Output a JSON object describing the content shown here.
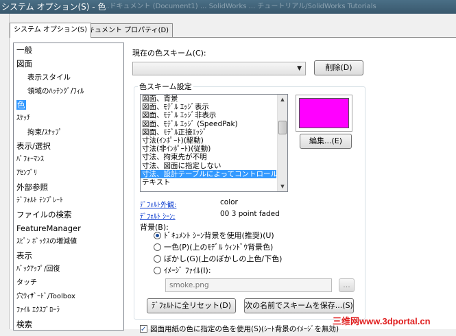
{
  "window": {
    "title": "システム オプション(S) - 色",
    "background_title": "...ドキュメント (Document1) ... SolidWorks ... チュートリアル/SolidWorks Tutorials"
  },
  "tabs": [
    {
      "label": "システム オプション(S)",
      "active": true
    },
    {
      "label": "ドキュメント プロパティ(D)",
      "active": false
    }
  ],
  "tree": {
    "items": [
      {
        "label": "一般",
        "level": 0,
        "selected": false
      },
      {
        "label": "図面",
        "level": 0,
        "selected": false
      },
      {
        "label": "表示スタイル",
        "level": 1,
        "selected": false
      },
      {
        "label": "領域のﾊｯﾁﾝｸﾞ/ﾌｨﾙ",
        "level": 1,
        "selected": false
      },
      {
        "label": "色",
        "level": 0,
        "selected": true
      },
      {
        "label": "ｽｹｯﾁ",
        "level": 0,
        "selected": false
      },
      {
        "label": "拘束/ｽﾅｯﾌﾟ",
        "level": 1,
        "selected": false
      },
      {
        "label": "表示/選択",
        "level": 0,
        "selected": false
      },
      {
        "label": "ﾊﾟﾌｫｰﾏﾝｽ",
        "level": 0,
        "selected": false
      },
      {
        "label": "ｱｾﾝﾌﾞﾘ",
        "level": 0,
        "selected": false
      },
      {
        "label": "外部参照",
        "level": 0,
        "selected": false
      },
      {
        "label": "ﾃﾞﾌｫﾙﾄ ﾃﾝﾌﾟﾚｰﾄ",
        "level": 0,
        "selected": false
      },
      {
        "label": "ファイルの検索",
        "level": 0,
        "selected": false
      },
      {
        "label": "FeatureManager",
        "level": 0,
        "selected": false
      },
      {
        "label": "ｽﾋﾟﾝ ﾎﾞｯｸｽの増減値",
        "level": 0,
        "selected": false
      },
      {
        "label": "表示",
        "level": 0,
        "selected": false
      },
      {
        "label": "ﾊﾞｯｸｱｯﾌﾟ/回復",
        "level": 0,
        "selected": false
      },
      {
        "label": "タッチ",
        "level": 0,
        "selected": false
      },
      {
        "label": "穴ｳｨｻﾞｰﾄﾞ/Toolbox",
        "level": 0,
        "selected": false
      },
      {
        "label": "ﾌｧｲﾙ ｴｸｽﾌﾟﾛｰﾗ",
        "level": 0,
        "selected": false
      },
      {
        "label": "検索",
        "level": 0,
        "selected": false
      }
    ]
  },
  "scheme": {
    "label": "現在の色スキーム(C):",
    "current_value": "",
    "delete_button": "削除(D)"
  },
  "color_settings": {
    "group_title": "色スキーム設定",
    "items": [
      {
        "label": "図面、背景",
        "selected": false
      },
      {
        "label": "図面、ﾓﾃﾞﾙ ｴｯｼﾞ表示",
        "selected": false
      },
      {
        "label": "図面、ﾓﾃﾞﾙ ｴｯｼﾞ非表示",
        "selected": false
      },
      {
        "label": "図面、ﾓﾃﾞﾙ ｴｯｼﾞ (SpeedPak)",
        "selected": false
      },
      {
        "label": "図面、ﾓﾃﾞﾙ正接ｴｯｼﾞ",
        "selected": false
      },
      {
        "label": "寸法(ｲﾝﾎﾟｰﾄ)(駆動)",
        "selected": false
      },
      {
        "label": "寸法(非ｲﾝﾎﾟｰﾄ)(従動)",
        "selected": false
      },
      {
        "label": "寸法、拘束先が不明",
        "selected": false
      },
      {
        "label": "寸法、図面に指定しない",
        "selected": false
      },
      {
        "label": "寸法、設計テーブルによってコントロール",
        "selected": true
      },
      {
        "label": "テキスト",
        "selected": false
      }
    ],
    "swatch_color": "#ff00ff",
    "edit_button": "編集...(E)"
  },
  "defaults": {
    "appearance_label": "ﾃﾞﾌｫﾙﾄ外観:",
    "appearance_value": "color",
    "scene_label": "ﾃﾞﾌｫﾙﾄ ｼｰﾝ:",
    "scene_value": "00 3 point faded"
  },
  "background": {
    "label": "背景(B):",
    "options": [
      {
        "label": "ﾄﾞｷｭﾒﾝﾄ ｼｰﾝ背景を使用(推奨)(U)",
        "selected": true
      },
      {
        "label": "一色(P)(上のﾓﾃﾞﾙ ｳｨﾝﾄﾞｳ背景色)",
        "selected": false
      },
      {
        "label": "ぼかし(G)(上のぼかしの上色/下色)",
        "selected": false
      },
      {
        "label": "ｲﾒｰｼﾞ ﾌｧｲﾙ(I):",
        "selected": false
      }
    ],
    "image_file": "smoke.png",
    "browse_button": "..."
  },
  "buttons": {
    "reset": "ﾃﾞﾌｫﾙﾄに全リセット(D)",
    "save_scheme": "次の名前でスキームを保存...(S)"
  },
  "bottom_checkbox": {
    "label": "図面用紙の色に指定の色を使用(S)(ｼｰﾄ背景のｲﾒｰｼﾞを無効)",
    "checked": true
  },
  "watermark": "三维网www.3dportal.cn"
}
